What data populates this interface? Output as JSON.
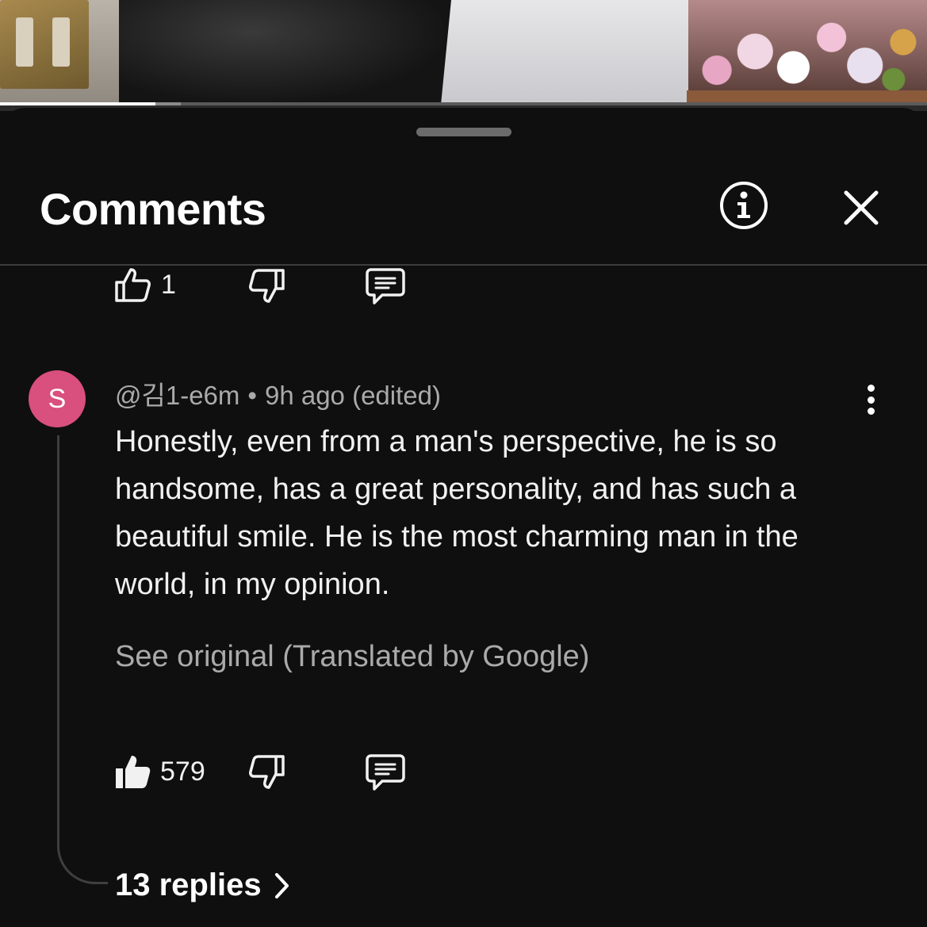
{
  "video": {
    "progress_fraction": 0.168,
    "buffered_fraction": 0.195
  },
  "sheet": {
    "title": "Comments"
  },
  "prev_comment": {
    "likes": "1"
  },
  "comment": {
    "avatar_initial": "S",
    "avatar_color": "#d94f7e",
    "handle": "@김1-e6m",
    "separator": "•",
    "time": "9h ago",
    "edited": "(edited)",
    "text": "Honestly, even from a man's perspective, he is so handsome, has a great personality, and has such a beautiful smile. He is the most charming man in the world, in my opinion.",
    "see_original": "See original (Translated by Google)",
    "likes": "579",
    "replies_label": "13 replies"
  },
  "icons": {
    "info": "info-icon",
    "close": "close-icon",
    "like_outline": "thumb-up-outline-icon",
    "like_filled": "thumb-up-filled-icon",
    "dislike": "thumb-down-icon",
    "reply": "comment-reply-icon",
    "more": "more-vertical-icon",
    "chevron": "chevron-right-icon"
  }
}
